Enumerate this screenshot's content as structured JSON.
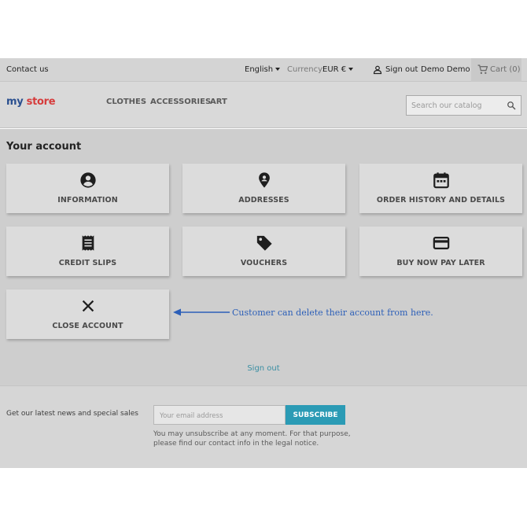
{
  "topbar": {
    "contact": "Contact us",
    "language": "English",
    "currency_label": "Currency:",
    "currency_value": "EUR €",
    "sign_out": "Sign out",
    "user_name": "Demo Demo",
    "cart": "Cart (0)"
  },
  "header": {
    "logo_part1": "my",
    "logo_part2": "store",
    "nav": [
      "CLOTHES",
      "ACCESSORIES",
      "ART"
    ],
    "search_placeholder": "Search our catalog",
    "search_icon": "search-icon"
  },
  "account": {
    "title": "Your account",
    "cards": [
      {
        "label": "INFORMATION",
        "icon": "account-circle-icon"
      },
      {
        "label": "ADDRESSES",
        "icon": "location-pin-icon"
      },
      {
        "label": "ORDER HISTORY AND DETAILS",
        "icon": "calendar-icon"
      },
      {
        "label": "CREDIT SLIPS",
        "icon": "receipt-icon"
      },
      {
        "label": "VOUCHERS",
        "icon": "tag-icon"
      },
      {
        "label": "BUY NOW PAY LATER",
        "icon": "credit-card-icon"
      },
      {
        "label": "CLOSE ACCOUNT",
        "icon": "close-icon"
      }
    ],
    "annotation": "Customer can delete their account from here.",
    "sign_out": "Sign out"
  },
  "footer": {
    "newsletter": "Get our latest news and special sales",
    "email_placeholder": "Your email address",
    "subscribe": "SUBSCRIBE",
    "notice_line1": "You may unsubscribe at any moment. For that purpose,",
    "notice_line2": "please find our contact info in the legal notice."
  },
  "colors": {
    "accent": "#2b9bb5",
    "annotation": "#2c5fb8",
    "logo_blue": "#2a4f8f",
    "logo_red": "#d63c3c"
  }
}
